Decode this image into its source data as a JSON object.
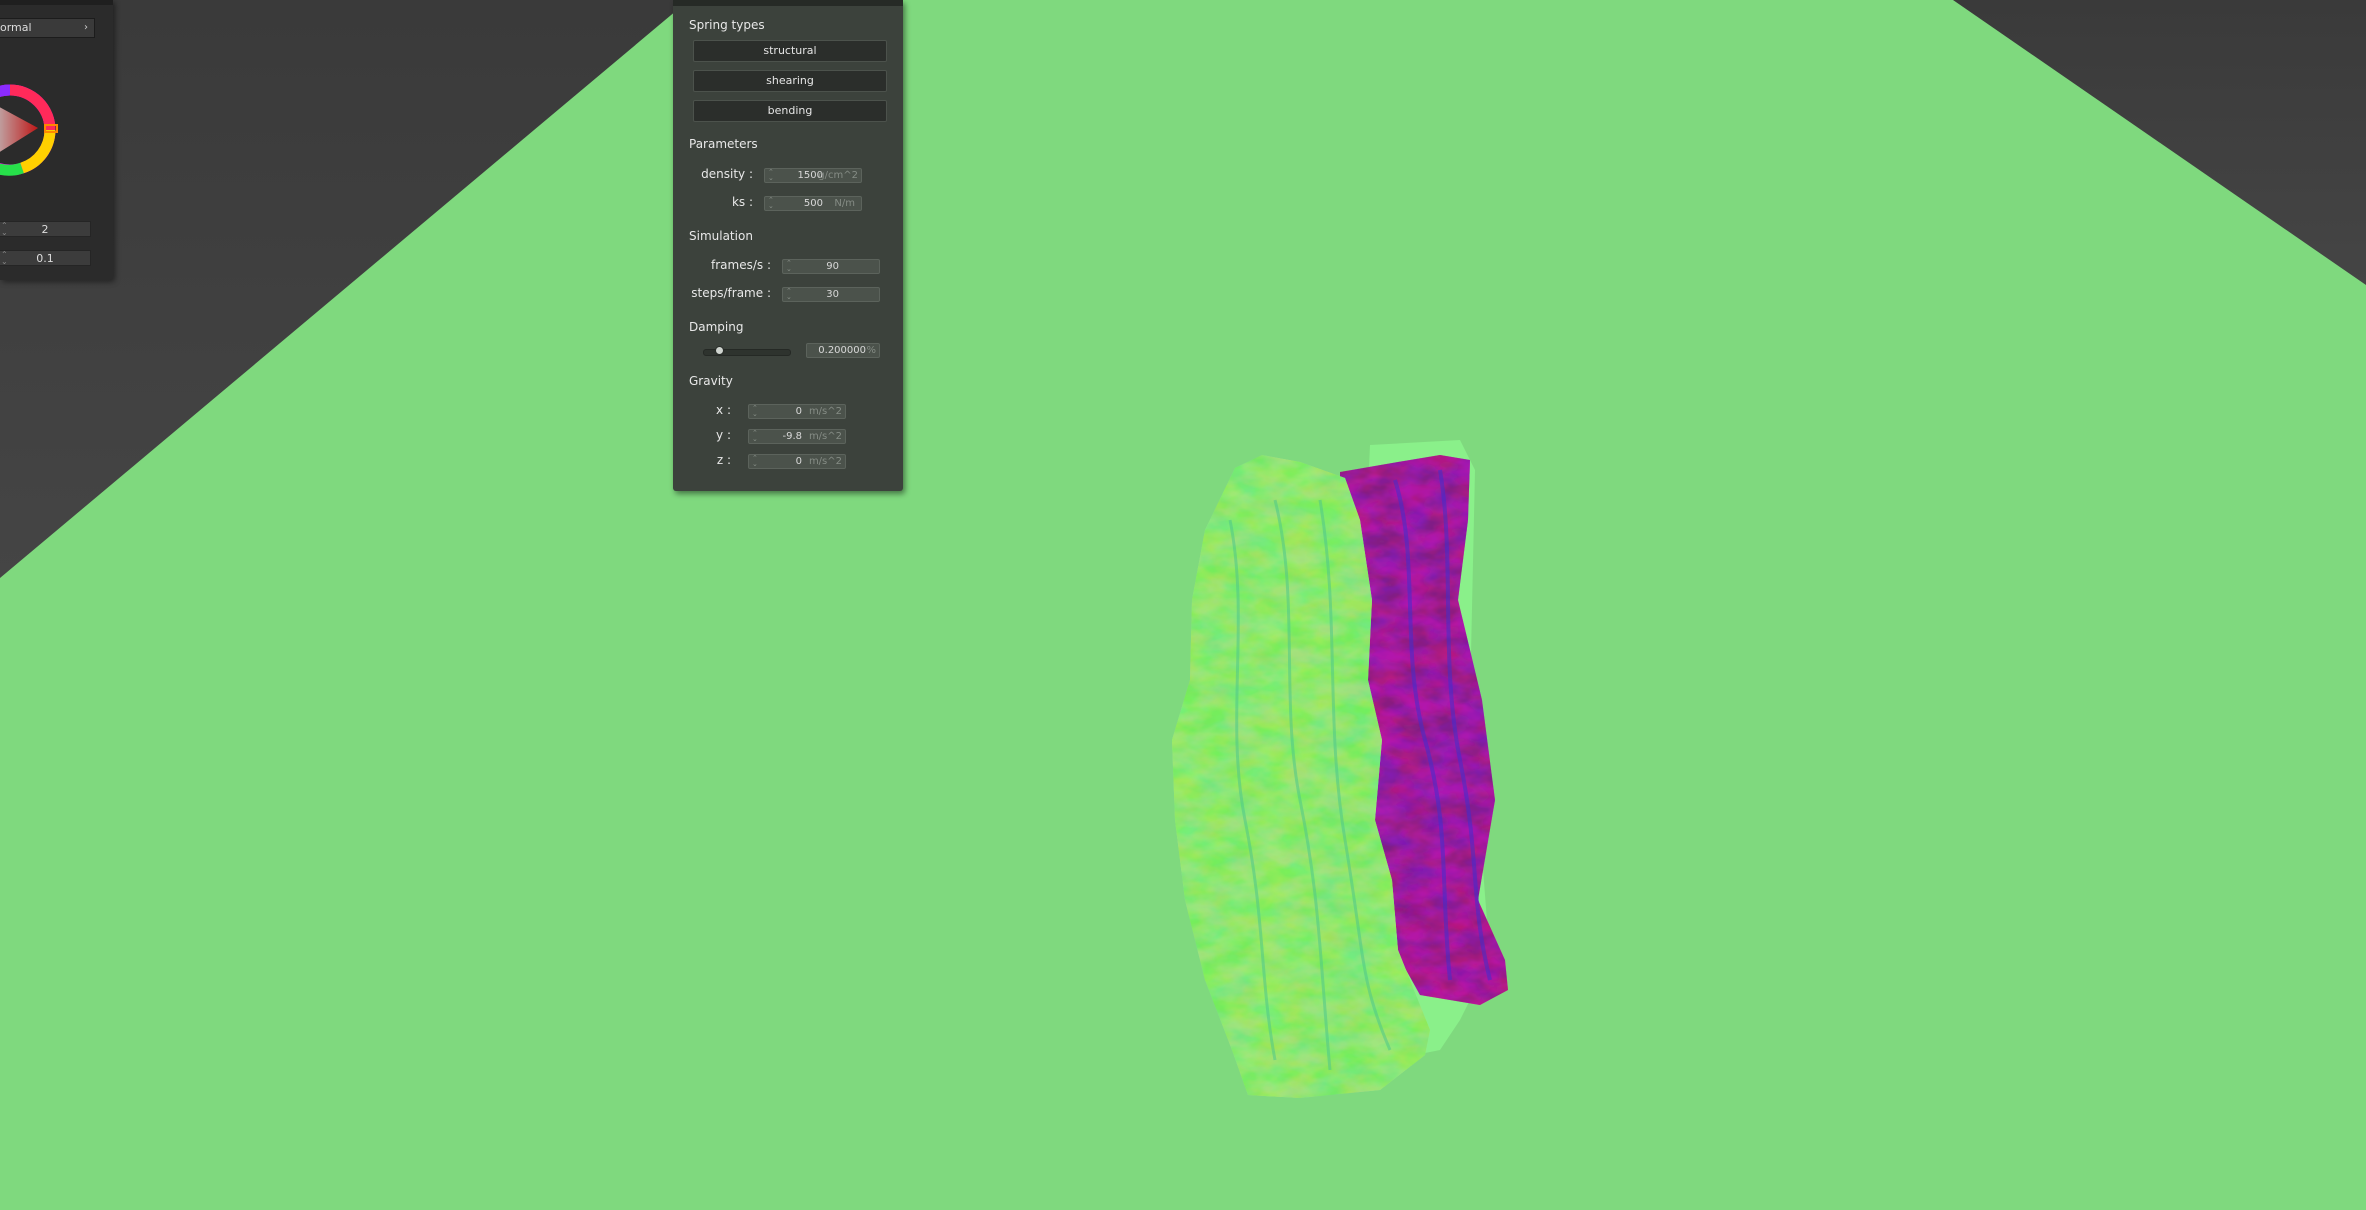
{
  "colors": {
    "ground": "#7fd97e",
    "background": "#3b3b3b",
    "panel": "#3c423c"
  },
  "left_panel": {
    "dropdown_value": "ormal",
    "field1_value": "2",
    "field2_value": "0.1"
  },
  "panel": {
    "spring_types": {
      "title": "Spring types",
      "buttons": [
        "structural",
        "shearing",
        "bending"
      ]
    },
    "parameters": {
      "title": "Parameters",
      "density": {
        "label": "density :",
        "value": "1500",
        "unit": "g/cm^2"
      },
      "ks": {
        "label": "ks :",
        "value": "500",
        "unit": "N/m"
      }
    },
    "simulation": {
      "title": "Simulation",
      "fps": {
        "label": "frames/s :",
        "value": "90"
      },
      "steps": {
        "label": "steps/frame :",
        "value": "30"
      }
    },
    "damping": {
      "title": "Damping",
      "value": "0.200000",
      "unit": "%",
      "level": 0.2
    },
    "gravity": {
      "title": "Gravity",
      "x": {
        "label": "x :",
        "value": "0",
        "unit": "m/s^2"
      },
      "y": {
        "label": "y :",
        "value": "-9.8",
        "unit": "m/s^2"
      },
      "z": {
        "label": "z :",
        "value": "0",
        "unit": "m/s^2"
      }
    }
  }
}
